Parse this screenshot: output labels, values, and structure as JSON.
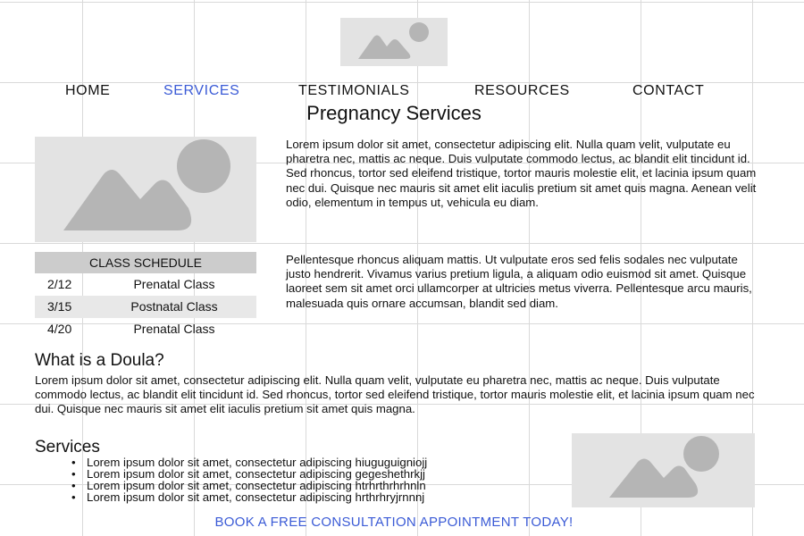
{
  "placeholders": {
    "logo": {
      "icon": "image-placeholder-icon"
    },
    "hero": {
      "icon": "image-placeholder-icon"
    },
    "services_image": {
      "icon": "image-placeholder-icon"
    }
  },
  "nav": {
    "items": [
      {
        "label": "HOME",
        "active": false
      },
      {
        "label": "SERVICES",
        "active": true
      },
      {
        "label": "TESTIMONIALS",
        "active": false
      },
      {
        "label": "RESOURCES",
        "active": false
      },
      {
        "label": "CONTACT",
        "active": false
      }
    ]
  },
  "page": {
    "title": "Pregnancy Services"
  },
  "intro": {
    "paragraphs": [
      "Lorem ipsum dolor sit amet, consectetur adipiscing elit. Nulla quam velit, vulputate eu pharetra nec, mattis ac neque. Duis vulputate commodo lectus, ac blandit elit tincidunt id. Sed rhoncus, tortor sed eleifend tristique, tortor mauris molestie elit, et lacinia ipsum quam nec dui. Quisque nec mauris sit amet elit iaculis pretium sit amet quis magna. Aenean velit odio, elementum in tempus ut, vehicula eu diam.",
      "Pellentesque rhoncus aliquam mattis. Ut vulputate eros sed felis sodales nec vulputate justo hendrerit. Vivamus varius pretium ligula, a aliquam odio euismod sit amet. Quisque laoreet sem sit amet orci ullamcorper at ultricies metus viverra. Pellentesque arcu mauris, malesuada quis ornare accumsan, blandit sed diam."
    ]
  },
  "schedule": {
    "header": "CLASS SCHEDULE",
    "rows": [
      {
        "date": "2/12",
        "name": "Prenatal Class"
      },
      {
        "date": "3/15",
        "name": "Postnatal Class"
      },
      {
        "date": "4/20",
        "name": "Prenatal Class"
      }
    ]
  },
  "doula": {
    "heading": "What is a Doula?",
    "body": "Lorem ipsum dolor sit amet, consectetur adipiscing elit. Nulla quam velit, vulputate eu pharetra nec, mattis ac neque. Duis vulputate commodo lectus, ac blandit elit tincidunt id. Sed rhoncus, tortor sed eleifend tristique, tortor mauris molestie elit, et lacinia ipsum quam nec dui. Quisque nec mauris sit amet elit iaculis pretium sit amet quis magna."
  },
  "services": {
    "heading": "Services",
    "items": [
      "Lorem ipsum dolor sit amet, consectetur adipiscing hiuguguigniojj",
      "Lorem ipsum dolor sit amet, consectetur adipiscing gegeshethrkjj",
      "Lorem ipsum dolor sit amet, consectetur adipiscing htrhrthrhrhnln",
      "Lorem ipsum dolor sit amet, consectetur adipiscing hrthrhryjrnnnj"
    ]
  },
  "cta": {
    "label": "BOOK A FREE CONSULTATION APPOINTMENT TODAY!"
  },
  "colors": {
    "link": "#3b5bd6",
    "placeholder_bg": "#e3e3e3",
    "placeholder_shape": "#b5b5b5",
    "schedule_header": "#cccccc",
    "schedule_alt_row": "#e8e8e8",
    "grid": "#d9d9d9"
  }
}
